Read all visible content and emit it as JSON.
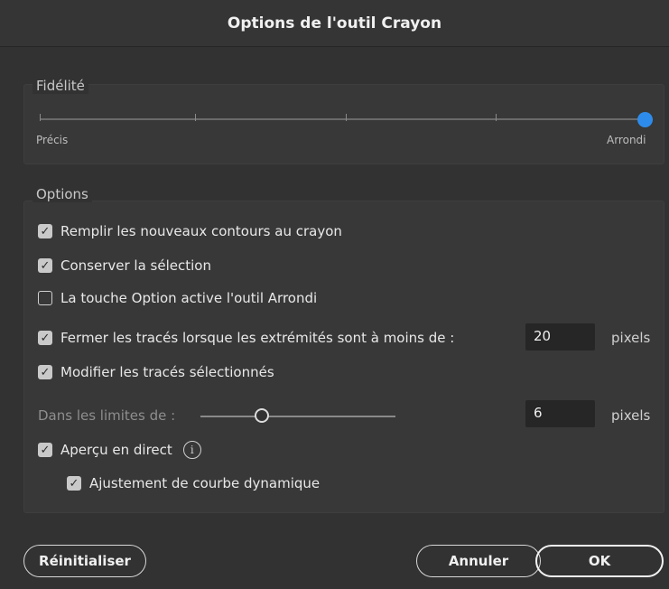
{
  "dialog": {
    "title": "Options de l'outil Crayon"
  },
  "fidelity": {
    "legend": "Fidélité",
    "min_label": "Précis",
    "max_label": "Arrondi",
    "level": 1.0
  },
  "options": {
    "legend": "Options",
    "fill_new": {
      "label": "Remplir les nouveaux contours au crayon",
      "checked": true
    },
    "keep_selected": {
      "label": "Conserver la sélection",
      "checked": true
    },
    "option_key": {
      "label": "La touche Option active l'outil Arrondi",
      "checked": false
    },
    "close_paths": {
      "label": "Fermer les tracés lorsque les extrémités sont à moins de :",
      "checked": true,
      "value": "20",
      "unit": "pixels"
    },
    "edit_selected": {
      "label": "Modifier les tracés sélectionnés",
      "checked": true
    },
    "within": {
      "label": "Dans les limites de :",
      "value": "6",
      "unit": "pixels",
      "level": 0.3
    },
    "live_preview": {
      "label": "Aperçu en direct",
      "checked": true,
      "info_icon": "info-icon"
    },
    "dynamic_curve": {
      "label": "Ajustement de courbe dynamique",
      "checked": true
    }
  },
  "buttons": {
    "reset": "Réinitialiser",
    "cancel": "Annuler",
    "ok": "OK"
  },
  "colors": {
    "accent": "#2d8ceb",
    "background": "#323232"
  }
}
